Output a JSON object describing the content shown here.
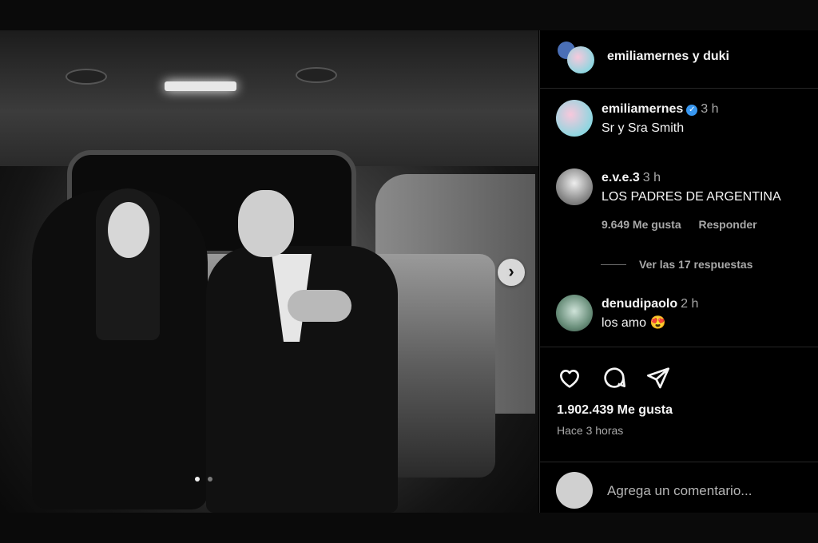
{
  "post": {
    "photo_alt": "",
    "carousel": {
      "total": 2,
      "active": 1,
      "next_symbol": "›"
    }
  },
  "header": {
    "authors": "emiliamernes y duki"
  },
  "comments": [
    {
      "username": "emiliamernes",
      "verified": true,
      "time": "3 h",
      "text": "Sr y Sra Smith"
    },
    {
      "username": "e.v.e.3",
      "time": "3 h",
      "text": "LOS PADRES DE ARGENTINA",
      "likes": "9.649 Me gusta",
      "reply": "Responder",
      "view_replies": "Ver las 17 respuestas"
    },
    {
      "username": "denudipaolo",
      "time": "2 h",
      "text": "los amo 😍"
    }
  ],
  "actions": {
    "icons": [
      "heart-icon",
      "comment-icon",
      "share-icon"
    ],
    "likes_count": "1.902.439 Me gusta",
    "posted": "Hace 3 horas"
  },
  "add_comment": {
    "placeholder": "Agrega un comentario..."
  },
  "colors": {
    "background": "#000000",
    "text": "#f5f5f5",
    "muted": "#a8a8a8",
    "verified": "#3897f0"
  }
}
